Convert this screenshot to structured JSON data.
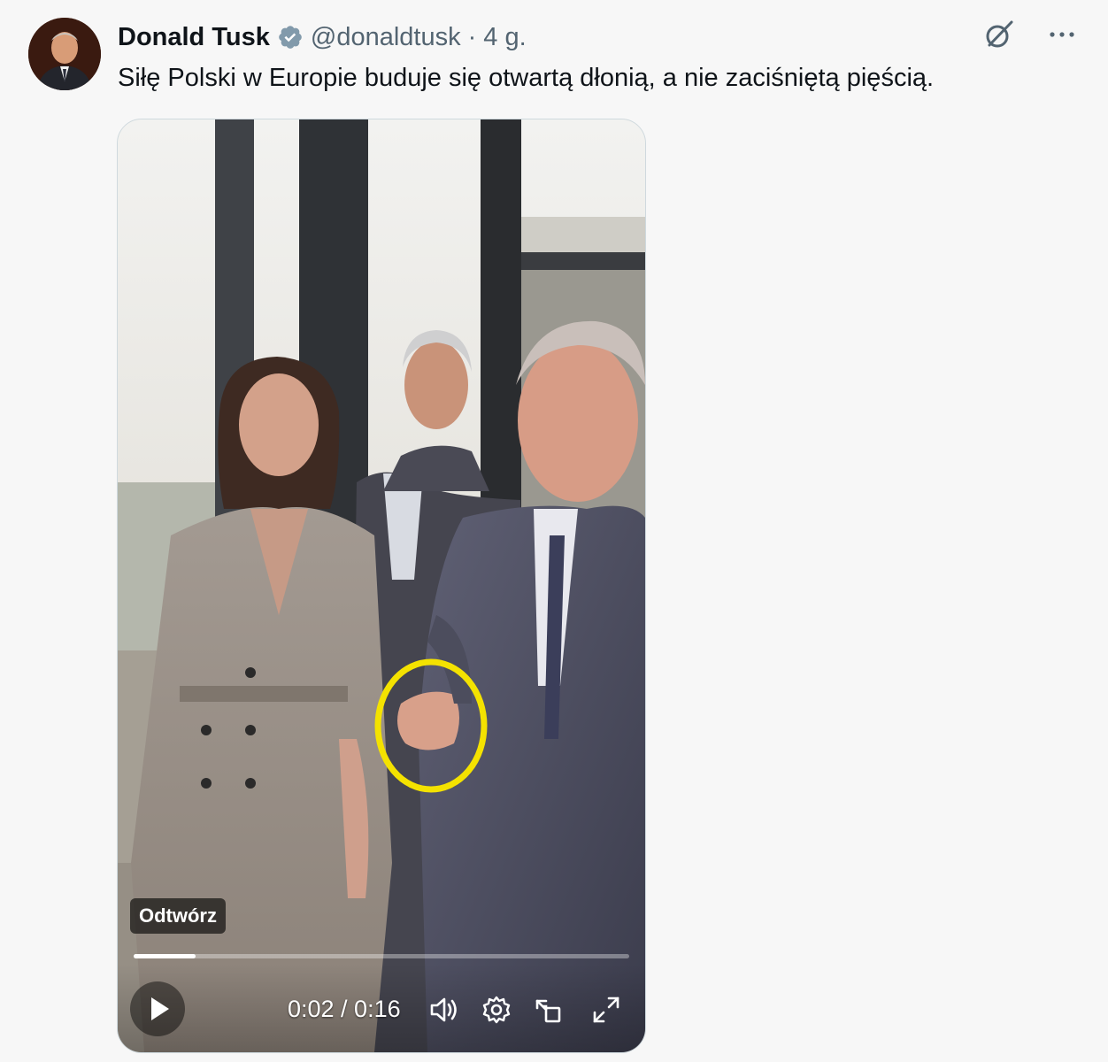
{
  "author": {
    "display_name": "Donald Tusk",
    "handle": "@donaldtusk",
    "separator": "·",
    "time": "4 g.",
    "verified_icon": "verified-badge-icon"
  },
  "tweet": {
    "text": "Siłę Polski w Europie buduje się otwartą dłonią, a nie zaciśniętą pięścią."
  },
  "video": {
    "play_label": "Odtwórz",
    "current_time": "0:02",
    "duration": "0:16",
    "timecode": "0:02 / 0:16",
    "progress": 0.125
  },
  "icons": {
    "grok": "grok-icon",
    "more": "more-icon",
    "play": "play-icon",
    "volume": "volume-icon",
    "settings": "settings-gear-icon",
    "pip": "picture-in-picture-icon",
    "fullscreen": "fullscreen-icon"
  },
  "colors": {
    "text_primary": "#0f1419",
    "text_secondary": "#536471",
    "verified_badge": "#829aab",
    "highlight_circle": "#f4e200"
  }
}
